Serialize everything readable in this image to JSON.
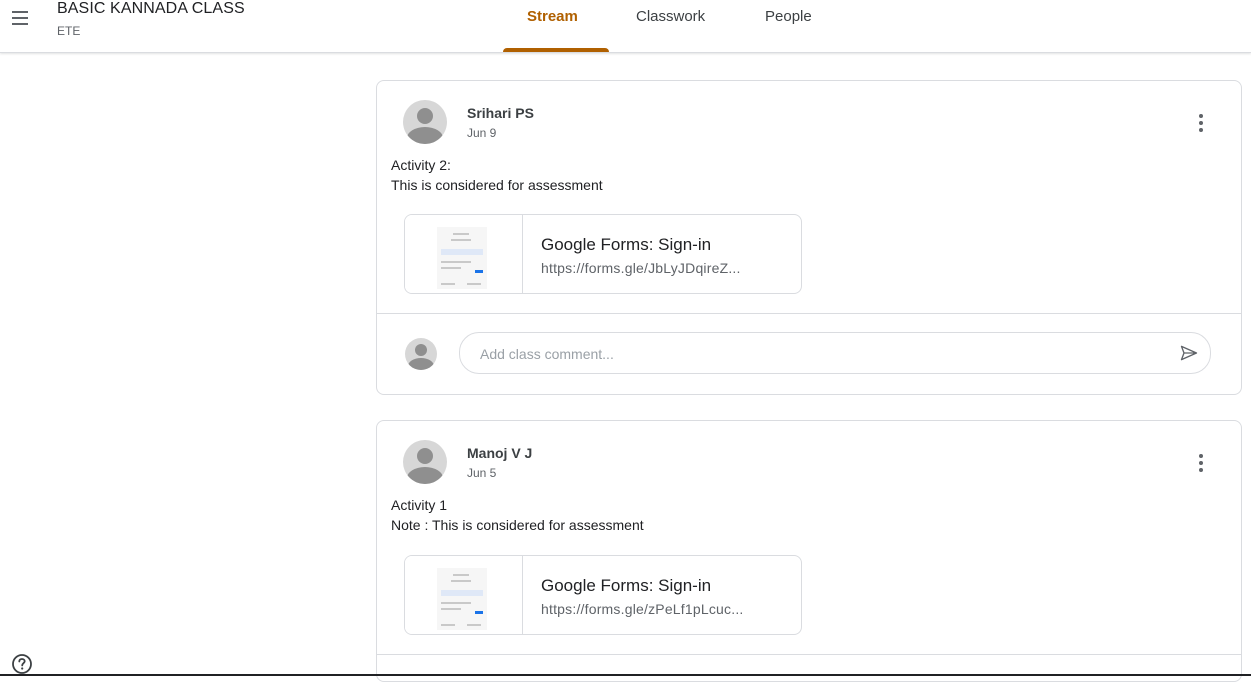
{
  "header": {
    "class_name": "BASIC KANNADA CLASS",
    "section": "ETE",
    "tabs": [
      {
        "label": "Stream",
        "active": true
      },
      {
        "label": "Classwork",
        "active": false
      },
      {
        "label": "People",
        "active": false
      }
    ]
  },
  "posts": [
    {
      "author": "Srihari PS",
      "date": "Jun 9",
      "lines": [
        "Activity 2:",
        "This is considered for assessment"
      ],
      "attachment": {
        "title": "Google Forms: Sign-in",
        "url": "https://forms.gle/JbLyJDqireZ..."
      },
      "comment_placeholder": "Add class comment..."
    },
    {
      "author": "Manoj V J",
      "date": "Jun 5",
      "lines": [
        "Activity 1",
        "Note : This is considered for assessment"
      ],
      "attachment": {
        "title": "Google Forms: Sign-in",
        "url": "https://forms.gle/zPeLf1pLcuc..."
      }
    }
  ],
  "colors": {
    "accent": "#b06000",
    "border": "#dadce0",
    "muted": "#5f6368"
  },
  "icons": [
    "menu-icon",
    "more-vert-icon",
    "send-icon",
    "help-icon",
    "avatar-icon"
  ]
}
